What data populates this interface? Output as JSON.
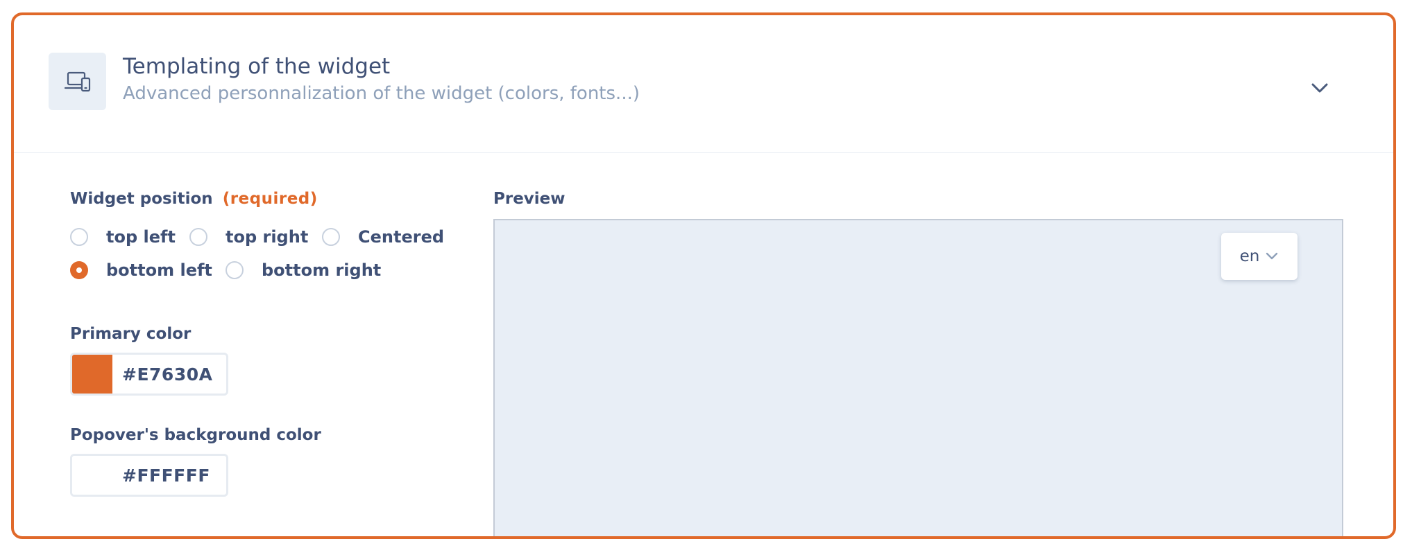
{
  "section": {
    "title": "Templating of the widget",
    "subtitle": "Advanced personnalization of the widget (colors, fonts...)",
    "header_icon": "devices-icon",
    "toggle_icon": "chevron-down-icon"
  },
  "position": {
    "label": "Widget position",
    "required": "(required)",
    "options": [
      {
        "label": "top left",
        "checked": false
      },
      {
        "label": "top right",
        "checked": false
      },
      {
        "label": "Centered",
        "checked": false
      },
      {
        "label": "bottom left",
        "checked": true
      },
      {
        "label": "bottom right",
        "checked": false
      }
    ]
  },
  "primary_color": {
    "label": "Primary color",
    "value": "#E7630A",
    "swatch": "#E0692A"
  },
  "popover_bg_color": {
    "label": "Popover's background color",
    "value": "#FFFFFF",
    "swatch": "#FFFFFF"
  },
  "preview": {
    "label": "Preview",
    "language": "en"
  },
  "colors": {
    "accent": "#E0692A",
    "text": "#3F5075",
    "muted": "#8EA0B9",
    "preview_bg": "#E8EEF6"
  }
}
